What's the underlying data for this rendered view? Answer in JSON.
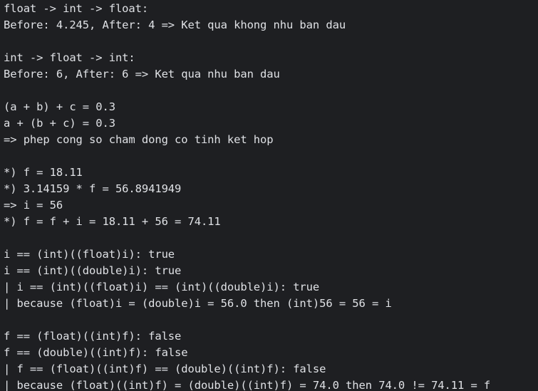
{
  "console": {
    "background": "#1e1f22",
    "text_color": "#dfe1e5",
    "lines": [
      "float -> int -> float:",
      "Before: 4.245, After: 4 => Ket qua khong nhu ban dau",
      "",
      "int -> float -> int:",
      "Before: 6, After: 6 => Ket qua nhu ban dau",
      "",
      "(a + b) + c = 0.3",
      "a + (b + c) = 0.3",
      "=> phep cong so cham dong co tinh ket hop",
      "",
      "*) f = 18.11",
      "*) 3.14159 * f = 56.8941949",
      "=> i = 56",
      "*) f = f + i = 18.11 + 56 = 74.11",
      "",
      "i == (int)((float)i): true",
      "i == (int)((double)i): true",
      "| i == (int)((float)i) == (int)((double)i): true",
      "| because (float)i = (double)i = 56.0 then (int)56 = 56 = i",
      "",
      "f == (float)((int)f): false",
      "f == (double)((int)f): false",
      "| f == (float)((int)f) == (double)((int)f): false",
      "| because (float)((int)f) = (double)((int)f) = 74.0 then 74.0 != 74.11 = f"
    ]
  }
}
